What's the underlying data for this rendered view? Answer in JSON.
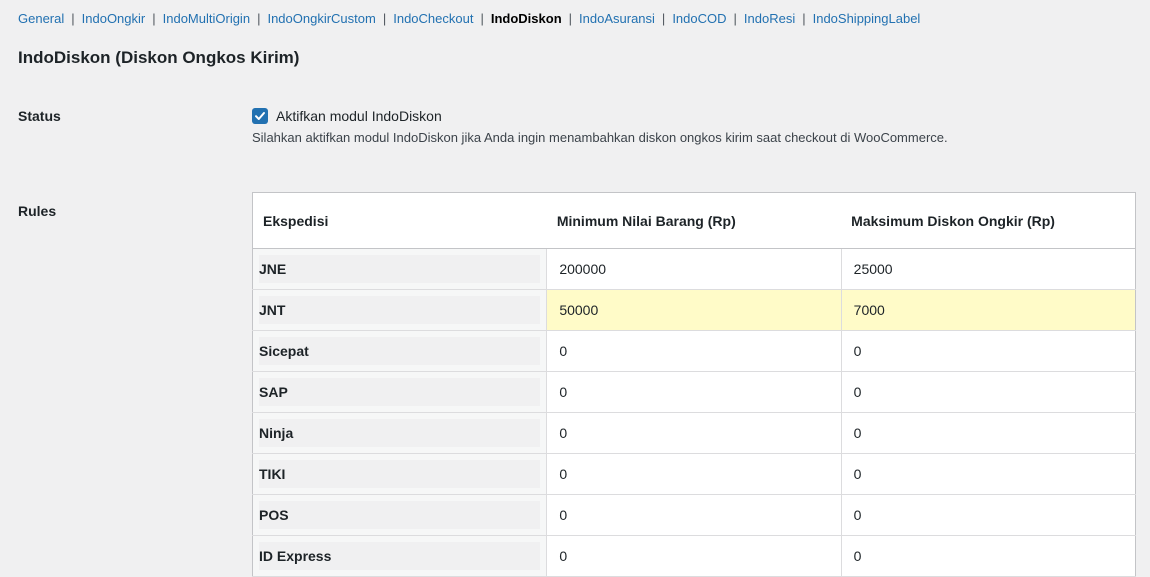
{
  "subnav": {
    "items": [
      {
        "label": "General",
        "current": false
      },
      {
        "label": "IndoOngkir",
        "current": false
      },
      {
        "label": "IndoMultiOrigin",
        "current": false
      },
      {
        "label": "IndoOngkirCustom",
        "current": false
      },
      {
        "label": "IndoCheckout",
        "current": false
      },
      {
        "label": "IndoDiskon",
        "current": true
      },
      {
        "label": "IndoAsuransi",
        "current": false
      },
      {
        "label": "IndoCOD",
        "current": false
      },
      {
        "label": "IndoResi",
        "current": false
      },
      {
        "label": "IndoShippingLabel",
        "current": false
      }
    ],
    "separator": "|"
  },
  "page_title": "IndoDiskon (Diskon Ongkos Kirim)",
  "status": {
    "label": "Status",
    "checkbox_label": "Aktifkan modul IndoDiskon",
    "checked": true,
    "description": "Silahkan aktifkan modul IndoDiskon jika Anda ingin menambahkan diskon ongkos kirim saat checkout di WooCommerce."
  },
  "rules": {
    "label": "Rules",
    "columns": [
      "Ekspedisi",
      "Minimum Nilai Barang (Rp)",
      "Maksimum Diskon Ongkir (Rp)"
    ],
    "rows": [
      {
        "courier": "JNE",
        "min": "200000",
        "max": "25000"
      },
      {
        "courier": "JNT",
        "min": "50000",
        "max": "7000"
      },
      {
        "courier": "Sicepat",
        "min": "0",
        "max": "0"
      },
      {
        "courier": "SAP",
        "min": "0",
        "max": "0"
      },
      {
        "courier": "Ninja",
        "min": "0",
        "max": "0"
      },
      {
        "courier": "TIKI",
        "min": "0",
        "max": "0"
      },
      {
        "courier": "POS",
        "min": "0",
        "max": "0"
      },
      {
        "courier": "ID Express",
        "min": "0",
        "max": "0"
      }
    ],
    "highlight_color": "#fffbc8"
  },
  "colors": {
    "link": "#2271b1",
    "checkbox": "#2271b1",
    "background": "#f0f0f1"
  }
}
